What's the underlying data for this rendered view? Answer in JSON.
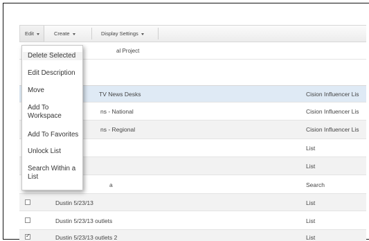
{
  "toolbar": {
    "edit_label": "Edit",
    "create_label": "Create",
    "display_label": "Display Settings"
  },
  "edit_menu": {
    "items": [
      "Delete Selected",
      "Edit Description",
      "Move",
      "Add To Workspace",
      "Add To Favorites",
      "Unlock List",
      "Search Within a List"
    ]
  },
  "list": {
    "breadcrumb_partial": "al Project",
    "rows": [
      {
        "name": "TV News Desks",
        "type": "Cision Influencer Lis",
        "checked": false,
        "highlight": true
      },
      {
        "name": "ns - National",
        "type": "Cision Influencer Lis",
        "checked": false
      },
      {
        "name": "ns - Regional",
        "type": "Cision Influencer Lis",
        "checked": false
      },
      {
        "name": "",
        "type": "List",
        "checked": false
      },
      {
        "name": "",
        "type": "List",
        "checked": false
      },
      {
        "name": "a",
        "type": "Search",
        "checked": false
      },
      {
        "name": "Dustin 5/23/13",
        "type": "List",
        "checked": false
      },
      {
        "name": "Dustin 5/23/13 outlets",
        "type": "List",
        "checked": false
      },
      {
        "name": "Dustin 5/23/13 outlets 2",
        "type": "List",
        "checked": true
      }
    ]
  },
  "colors": {
    "highlight_row": "#dfeaf5",
    "alt_row": "#f2f2f2",
    "toolbar_bg": "#ececec"
  }
}
